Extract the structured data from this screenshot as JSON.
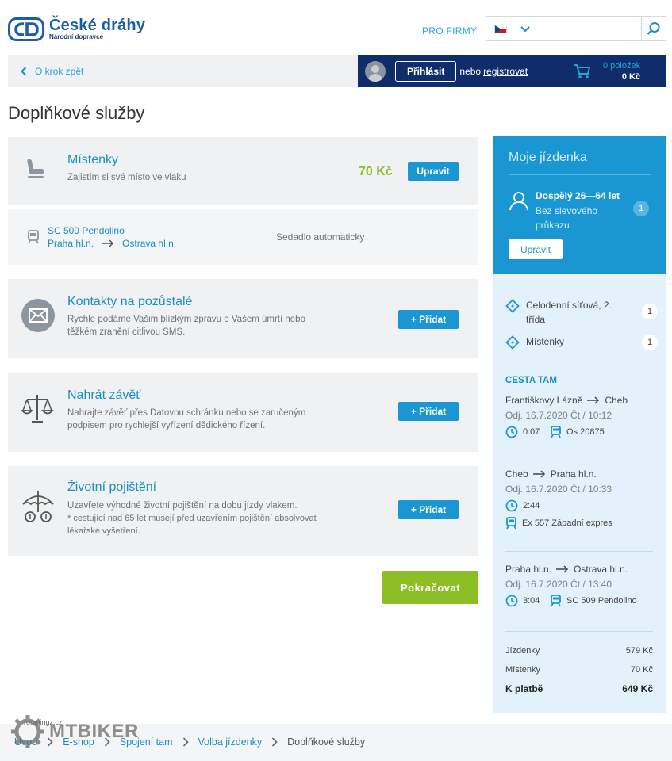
{
  "brand": {
    "name": "České dráhy",
    "subtitle": "Národní dopravce"
  },
  "header": {
    "pro_firmy": "PRO FIRMY",
    "language": "CZ",
    "search": {
      "value": "",
      "placeholder": ""
    }
  },
  "nav": {
    "back": "O krok zpět",
    "login": "Přihlásit",
    "or": "nebo",
    "register": "registrovat",
    "cart": {
      "count": "0 položek",
      "price": "0 Kč"
    }
  },
  "page_title": "Doplňkové služby",
  "services": {
    "seats": {
      "title": "Místenky",
      "desc": "Zajistím si své místo ve vlaku",
      "price": "70 Kč",
      "button": "Upravit",
      "detail": {
        "train": "SC 509 Pendolino",
        "from": "Praha hl.n.",
        "to": "Ostrava hl.n.",
        "seat": "Sedadlo automaticky"
      }
    },
    "contacts": {
      "title": "Kontakty na pozůstalé",
      "desc": "Rychle podáme Vašim blízkým zprávu o Vašem úmrtí nebo těžkém zranění citlivou SMS.",
      "button": "+ Přidat"
    },
    "will": {
      "title": "Nahrát závěť",
      "desc": "Nahrajte závěť přes Datovou schránku nebo se zaručeným podpisem pro rychlejší vyřízení dědického řízení.",
      "button": "+ Přidat"
    },
    "insurance": {
      "title": "Životní pojištění",
      "desc": "Uzavřete výhodné životní pojištění na dobu jízdy vlakem.",
      "note": "* cestující nad 65 let musejí před uzavřením pojištění absolvovat lékařské vyšetření.",
      "button": "+ Přidat"
    }
  },
  "continue": "Pokračovat",
  "ticket": {
    "title": "Moje jízdenka",
    "passenger": {
      "name": "Dospělý 26—64 let",
      "sub": "Bez slevového průkazu",
      "count": "1"
    },
    "edit": "Upravit",
    "items": [
      {
        "label": "Celodenní síťová, 2. třída",
        "count": "1"
      },
      {
        "label": "Místenky",
        "count": "1"
      }
    ],
    "section": "CESTA TAM",
    "legs": [
      {
        "from": "Františkovy Lázně",
        "to": "Cheb",
        "date": "Odj. 16.7.2020 Čt / 10:12",
        "duration": "0:07",
        "train": "Os 20875"
      },
      {
        "from": "Cheb",
        "to": "Praha hl.n.",
        "date": "Odj. 16.7.2020 Čt / 10:33",
        "duration": "2:44",
        "train": "Ex 557 Západní expres"
      },
      {
        "from": "Praha hl.n.",
        "to": "Ostrava hl.n.",
        "date": "Odj. 16.7.2020 Čt / 13:40",
        "duration": "3:04",
        "train": "SC 509 Pendolino"
      }
    ],
    "totals": [
      {
        "label": "Jízdenky",
        "value": "579 Kč"
      },
      {
        "label": "Místenky",
        "value": "70 Kč"
      },
      {
        "label": "K platbě",
        "value": "649 Kč"
      }
    ]
  },
  "breadcrumb": [
    "Úvod",
    "E-shop",
    "Spojení tam",
    "Volba jízdenky",
    "Doplňkové služby"
  ],
  "watermark": {
    "text": "MTBIKER",
    "small": "roumingz.cz"
  },
  "colors": {
    "navy": "#0f2c6b",
    "blue": "#1a97d2",
    "green": "#8cbf26",
    "light_blue_panel": "#e3f1fa"
  }
}
